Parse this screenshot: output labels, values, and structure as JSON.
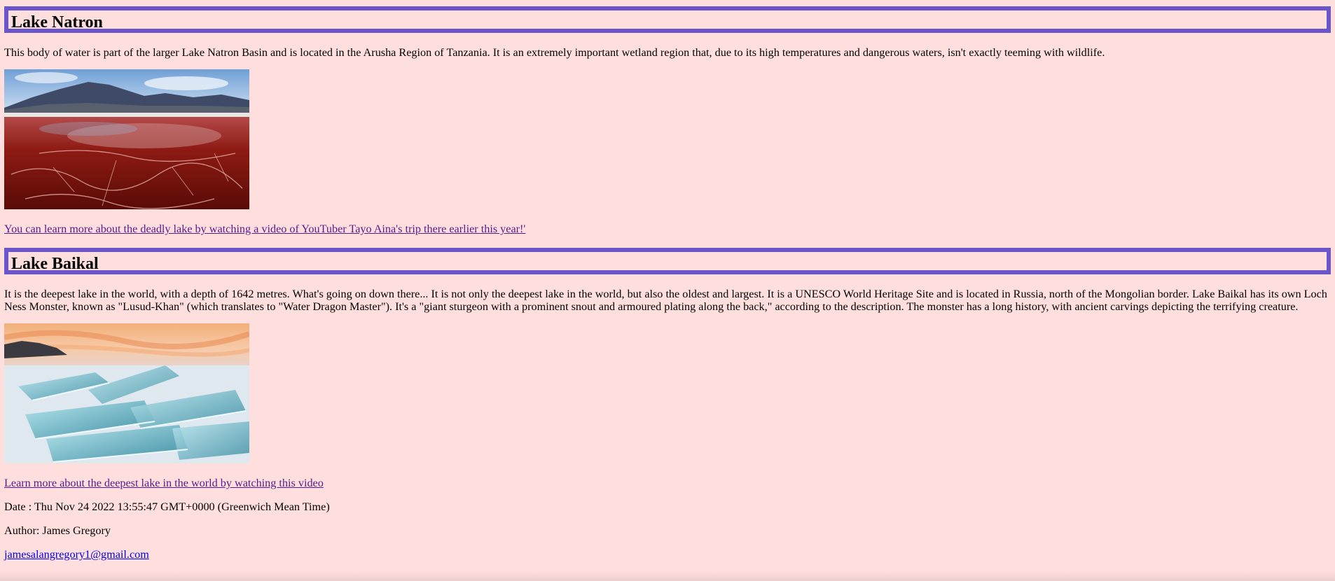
{
  "sections": [
    {
      "title": "Lake Natron",
      "description": "This body of water is part of the larger Lake Natron Basin and is located in the Arusha Region of Tanzania. It is an extremely important wetland region that, due to its high temperatures and dangerous waters, isn't exactly teeming with wildlife.",
      "image_icon": "lake-natron-photo",
      "link_text": "You can learn more about the deadly lake by watching a video of YouTuber Tayo Aina's trip there earlier this year!'"
    },
    {
      "title": "Lake Baikal",
      "description": "It is the deepest lake in the world, with a depth of 1642 metres. What's going on down there... It is not only the deepest lake in the world, but also the oldest and largest. It is a UNESCO World Heritage Site and is located in Russia, north of the Mongolian border. Lake Baikal has its own Loch Ness Monster, known as \"Lusud-Khan\" (which translates to \"Water Dragon Master\"). It's a \"giant sturgeon with a prominent snout and armoured plating along the back,\" according to the description. The monster has a long history, with ancient carvings depicting the terrifying creature.",
      "image_icon": "lake-baikal-photo",
      "link_text": "Learn more about the deepest lake in the world by watching this video"
    }
  ],
  "footer": {
    "date": "Date : Thu Nov 24 2022 13:55:47 GMT+0000 (Greenwich Mean Time)",
    "author": "Author: James Gregory",
    "email": "jamesalangregory1@gmail.com"
  },
  "colors": {
    "background": "#ffdfdd",
    "heading_border": "#6a55c9",
    "visited_link": "#551a8b",
    "link": "#0000ee"
  }
}
